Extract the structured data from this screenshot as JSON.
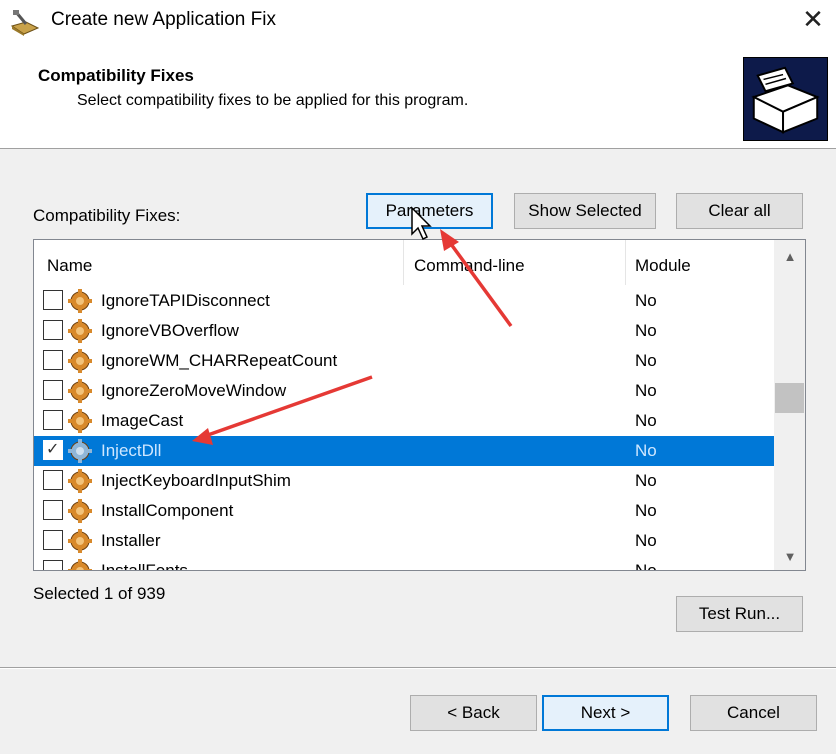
{
  "window": {
    "title": "Create new Application Fix",
    "close_glyph": "✕"
  },
  "header": {
    "title": "Compatibility Fixes",
    "subtitle": "Select compatibility fixes to be applied for this program."
  },
  "fixes_label": "Compatibility Fixes:",
  "buttons": {
    "parameters": "Parameters",
    "show_selected": "Show Selected",
    "clear_all": "Clear all",
    "test_run": "Test Run...",
    "back": "< Back",
    "next": "Next >",
    "cancel": "Cancel"
  },
  "list": {
    "columns": [
      "Name",
      "Command-line",
      "Module"
    ],
    "rows": [
      {
        "name": "IgnoreTAPIDisconnect",
        "command_line": "",
        "module": "No",
        "checked": false,
        "selected": false
      },
      {
        "name": "IgnoreVBOverflow",
        "command_line": "",
        "module": "No",
        "checked": false,
        "selected": false
      },
      {
        "name": "IgnoreWM_CHARRepeatCount",
        "command_line": "",
        "module": "No",
        "checked": false,
        "selected": false
      },
      {
        "name": "IgnoreZeroMoveWindow",
        "command_line": "",
        "module": "No",
        "checked": false,
        "selected": false
      },
      {
        "name": "ImageCast",
        "command_line": "",
        "module": "No",
        "checked": false,
        "selected": false
      },
      {
        "name": "InjectDll",
        "command_line": "",
        "module": "No",
        "checked": true,
        "selected": true
      },
      {
        "name": "InjectKeyboardInputShim",
        "command_line": "",
        "module": "No",
        "checked": false,
        "selected": false
      },
      {
        "name": "InstallComponent",
        "command_line": "",
        "module": "No",
        "checked": false,
        "selected": false
      },
      {
        "name": "Installer",
        "command_line": "",
        "module": "No",
        "checked": false,
        "selected": false
      },
      {
        "name": "InstallFonts",
        "command_line": "",
        "module": "No",
        "checked": false,
        "selected": false
      }
    ]
  },
  "selected_count": "Selected 1 of 939",
  "icons": {
    "app": "application-fix-icon",
    "wizard": "wizard-box-icon",
    "row": "gear-icon"
  },
  "colors": {
    "selection": "#0078d7",
    "annotation_arrow": "#e53935"
  }
}
